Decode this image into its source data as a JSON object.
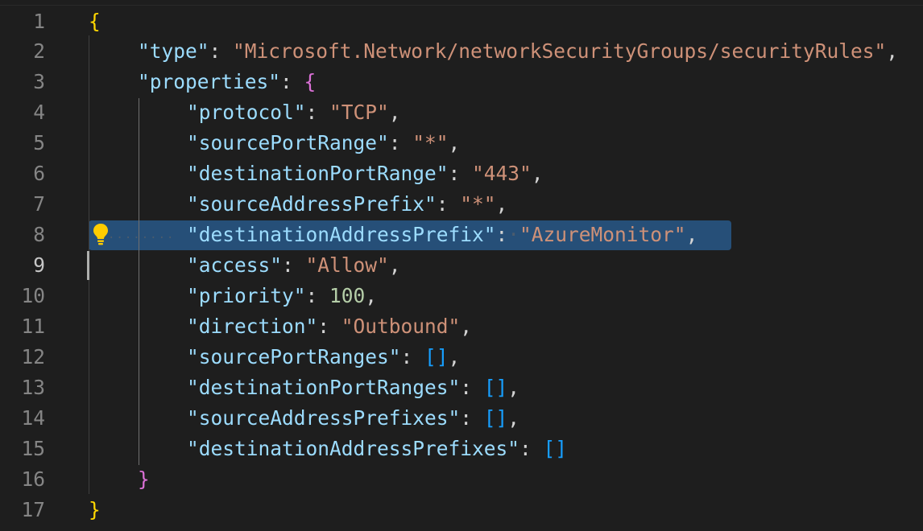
{
  "editor": {
    "active_line": 9,
    "highlighted_line": 8,
    "lightbulb_icon": "lightbulb-icon",
    "colors": {
      "background": "#1e1e1e",
      "selection": "#264f78",
      "key": "#9cdcfe",
      "string": "#ce9178",
      "number": "#b5cea8",
      "bracket_level1": "#ffd700",
      "bracket_level2": "#da70d6",
      "bracket_level3": "#179fff"
    },
    "line_numbers": [
      "1",
      "2",
      "3",
      "4",
      "5",
      "6",
      "7",
      "8",
      "9",
      "10",
      "11",
      "12",
      "13",
      "14",
      "15",
      "16",
      "17"
    ],
    "lines": [
      {
        "open_brace": "{"
      },
      {
        "key": "\"type\"",
        "colon": ": ",
        "value": "\"Microsoft.Network/networkSecurityGroups/securityRules\"",
        "comma": ","
      },
      {
        "key": "\"properties\"",
        "colon": ": ",
        "open_brace": "{"
      },
      {
        "key": "\"protocol\"",
        "colon": ": ",
        "value": "\"TCP\"",
        "comma": ","
      },
      {
        "key": "\"sourcePortRange\"",
        "colon": ": ",
        "value": "\"*\"",
        "comma": ","
      },
      {
        "key": "\"destinationPortRange\"",
        "colon": ": ",
        "value": "\"443\"",
        "comma": ","
      },
      {
        "key": "\"sourceAddressPrefix\"",
        "colon": ": ",
        "value": "\"*\"",
        "comma": ","
      },
      {
        "whitespace": "········",
        "key": "\"destinationAddressPrefix\"",
        "colon": ":",
        "ws_dot": "·",
        "value": "\"AzureMonitor\"",
        "comma": ","
      },
      {
        "key": "\"access\"",
        "colon": ": ",
        "value": "\"Allow\"",
        "comma": ","
      },
      {
        "key": "\"priority\"",
        "colon": ": ",
        "value": "100",
        "comma": ","
      },
      {
        "key": "\"direction\"",
        "colon": ": ",
        "value": "\"Outbound\"",
        "comma": ","
      },
      {
        "key": "\"sourcePortRanges\"",
        "colon": ": ",
        "value": "[]",
        "comma": ","
      },
      {
        "key": "\"destinationPortRanges\"",
        "colon": ": ",
        "value": "[]",
        "comma": ","
      },
      {
        "key": "\"sourceAddressPrefixes\"",
        "colon": ": ",
        "value": "[]",
        "comma": ","
      },
      {
        "key": "\"destinationAddressPrefixes\"",
        "colon": ": ",
        "value": "[]"
      },
      {
        "close_brace": "}"
      },
      {
        "close_brace": "}"
      }
    ]
  }
}
